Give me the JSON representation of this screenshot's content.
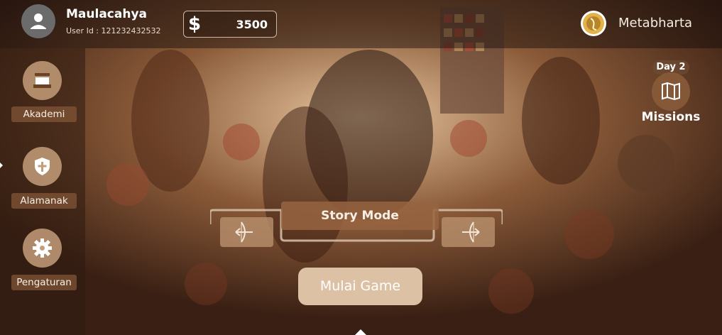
{
  "user": {
    "name": "Maulacahya",
    "id_text": "User Id : 121232432532"
  },
  "currency": {
    "symbol": "$",
    "amount": "3500"
  },
  "brand": {
    "name": "Metabharta"
  },
  "sidebar": {
    "items": [
      {
        "label": "Akademi",
        "icon": "building-icon"
      },
      {
        "label": "Alamanak",
        "icon": "shield-icon"
      },
      {
        "label": "Pengaturan",
        "icon": "gear-icon"
      }
    ]
  },
  "missions": {
    "day_text": "Day 2",
    "label": "Missions",
    "icon": "map-icon"
  },
  "mode": {
    "label": "Story Mode",
    "prev_icon": "bow-left-icon",
    "next_icon": "bow-right-icon"
  },
  "start_button": {
    "label": "Mulai Game"
  },
  "colors": {
    "accent": "#dcc1a5",
    "sidebar_bg": "#5a3520",
    "label_bg": "#825537"
  }
}
